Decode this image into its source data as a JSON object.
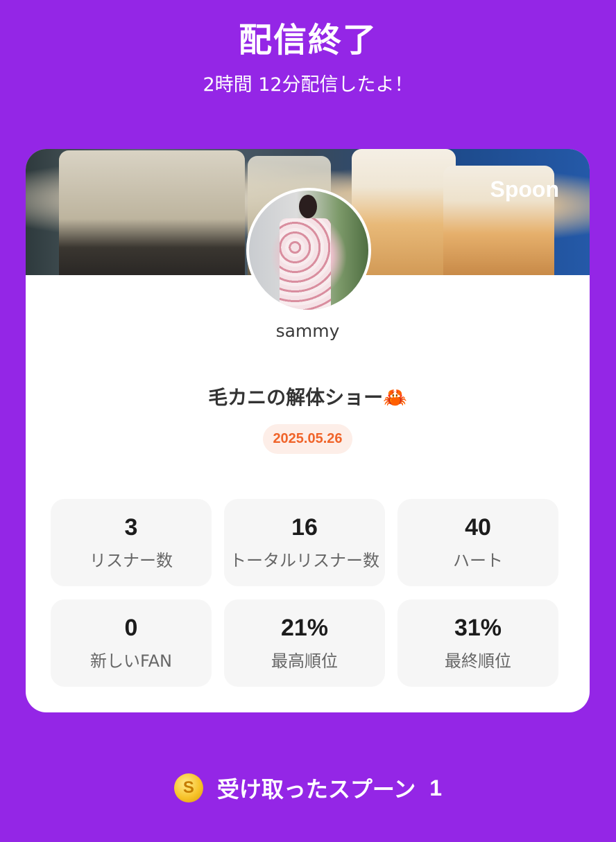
{
  "header": {
    "title": "配信終了",
    "subtitle": "2時間 12分配信したよ！"
  },
  "card": {
    "brand": "Spoon",
    "username": "sammy",
    "title": "毛カニの解体ショー🦀",
    "date": "2025.05.26",
    "stats": [
      {
        "value": "3",
        "label": "リスナー数"
      },
      {
        "value": "16",
        "label": "トータルリスナー数"
      },
      {
        "value": "40",
        "label": "ハート"
      },
      {
        "value": "0",
        "label": "新しいFAN"
      },
      {
        "value": "21%",
        "label": "最高順位"
      },
      {
        "value": "31%",
        "label": "最終順位"
      }
    ]
  },
  "footer": {
    "coin_symbol": "S",
    "label": "受け取ったスプーン",
    "count": "1"
  }
}
